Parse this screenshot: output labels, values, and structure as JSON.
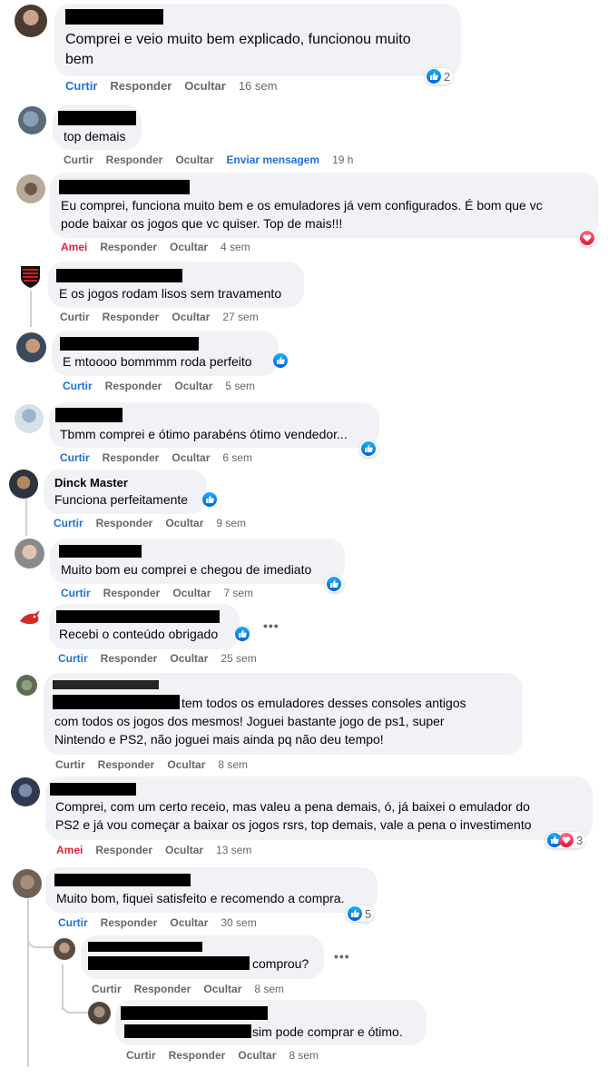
{
  "comments": [
    {
      "text": "Comprei e veio muito bem explicado, funcionou muito\nbem",
      "actions": {
        "like": "Curtir",
        "reply": "Responder",
        "hide": "Ocultar"
      },
      "time": "16 sem",
      "reaction_count": "2"
    },
    {
      "text": "top demais",
      "actions": {
        "like": "Curtir",
        "reply": "Responder",
        "hide": "Ocultar",
        "message": "Enviar mensagem"
      },
      "time": "19 h"
    },
    {
      "text": "Eu comprei, funciona muito bem e os emuladores já vem configurados. É bom que vc\npode baixar os jogos que vc quiser. Top de mais!!!",
      "actions": {
        "like": "Amei",
        "reply": "Responder",
        "hide": "Ocultar"
      },
      "time": "4 sem"
    },
    {
      "text": "E os jogos rodam lisos sem travamento",
      "actions": {
        "like": "Curtir",
        "reply": "Responder",
        "hide": "Ocultar"
      },
      "time": "27 sem"
    },
    {
      "text": "E mtoooo bommmm roda perfeito",
      "actions": {
        "like": "Curtir",
        "reply": "Responder",
        "hide": "Ocultar"
      },
      "time": "5 sem"
    },
    {
      "text": "Tbmm comprei e ótimo parabéns ótimo vendedor...",
      "actions": {
        "like": "Curtir",
        "reply": "Responder",
        "hide": "Ocultar"
      },
      "time": "6 sem"
    },
    {
      "name": "Dinck Master",
      "text": "Funciona perfeitamente",
      "actions": {
        "like": "Curtir",
        "reply": "Responder",
        "hide": "Ocultar"
      },
      "time": "9 sem"
    },
    {
      "text": "Muito bom eu comprei e chegou de imediato",
      "actions": {
        "like": "Curtir",
        "reply": "Responder",
        "hide": "Ocultar"
      },
      "time": "7 sem"
    },
    {
      "text": "Recebi o conteúdo obrigado",
      "actions": {
        "like": "Curtir",
        "reply": "Responder",
        "hide": "Ocultar"
      },
      "time": "25 sem",
      "menu": "•••"
    },
    {
      "text_line1": "tem todos os emuladores desses consoles antigos",
      "text_rest": "com todos os jogos dos mesmos! Joguei bastante jogo de ps1, super\nNintendo e PS2, não joguei mais ainda pq não deu tempo!",
      "actions": {
        "like": "Curtir",
        "reply": "Responder",
        "hide": "Ocultar"
      },
      "time": "8 sem"
    },
    {
      "text": "Comprei, com um certo receio, mas valeu a pena demais, ó, já baixei o emulador do\nPS2 e já vou começar a baixar os jogos rsrs, top demais, vale a pena o investimento",
      "actions": {
        "like": "Amei",
        "reply": "Responder",
        "hide": "Ocultar"
      },
      "time": "13 sem",
      "reaction_count": "3"
    },
    {
      "text": "Muito bom, fiquei satisfeito e recomendo a compra.",
      "actions": {
        "like": "Curtir",
        "reply": "Responder",
        "hide": "Ocultar"
      },
      "time": "30 sem",
      "reaction_count": "5"
    },
    {
      "text": "comprou?",
      "actions": {
        "like": "Curtir",
        "reply": "Responder",
        "hide": "Ocultar"
      },
      "time": "8 sem",
      "menu": "•••"
    },
    {
      "text": "sim pode comprar e ótimo.",
      "actions": {
        "like": "Curtir",
        "reply": "Responder",
        "hide": "Ocultar"
      },
      "time": "8 sem"
    }
  ],
  "colors": {
    "bubble": "#f0f2f5",
    "like_blue": "#216fdb",
    "love_red": "#e41e3f",
    "muted": "#65676b"
  },
  "icons": {
    "like": "thumbs-up-icon",
    "love": "heart-icon",
    "more": "more-options-icon"
  }
}
